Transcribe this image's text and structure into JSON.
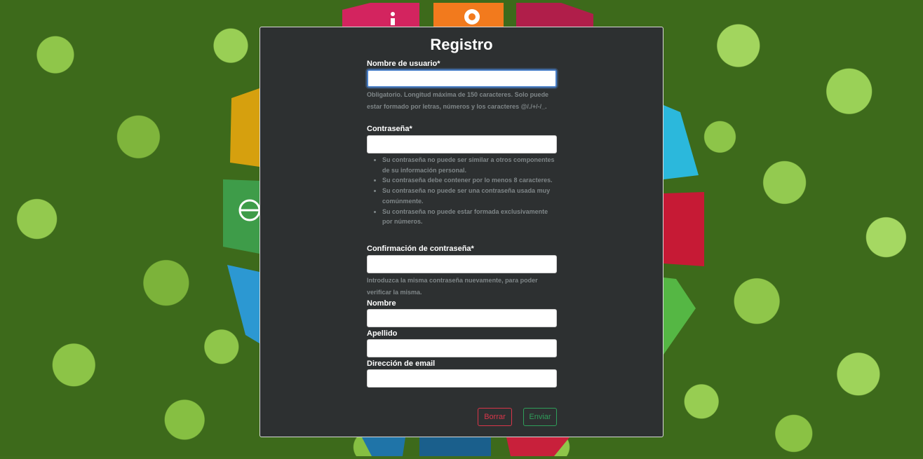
{
  "form": {
    "title": "Registro",
    "username": {
      "label": "Nombre de usuario*",
      "value": "",
      "help": "Obligatorio. Longitud máxima de 150 caracteres. Solo puede estar formado por letras, números y los caracteres @/./+/-/_."
    },
    "password": {
      "label": "Contraseña*",
      "value": "",
      "rules": [
        "Su contraseña no puede ser similar a otros componentes de su información personal.",
        "Su contraseña debe contener por lo menos 8 caracteres.",
        "Su contraseña no puede ser una contraseña usada muy comúnmente.",
        "Su contraseña no puede estar formada exclusivamente por números."
      ]
    },
    "password_confirm": {
      "label": "Confirmación de contraseña*",
      "value": "",
      "help": "Introduzca la misma contraseña nuevamente, para poder verificar la misma."
    },
    "first_name": {
      "label": "Nombre",
      "value": ""
    },
    "last_name": {
      "label": "Apellido",
      "value": ""
    },
    "email": {
      "label": "Dirección de email",
      "value": ""
    },
    "buttons": {
      "clear": "Borrar",
      "submit": "Enviar"
    }
  },
  "colors": {
    "panel_bg": "#2d3031",
    "focus_border": "#4a7fc7",
    "clear_button": "#d9364a",
    "submit_button": "#2f9e5a",
    "help_text": "#7f8688"
  },
  "background": {
    "icons": [
      "sdg-wheel-icon",
      "gear-icon",
      "globe-leaf-icon"
    ]
  }
}
